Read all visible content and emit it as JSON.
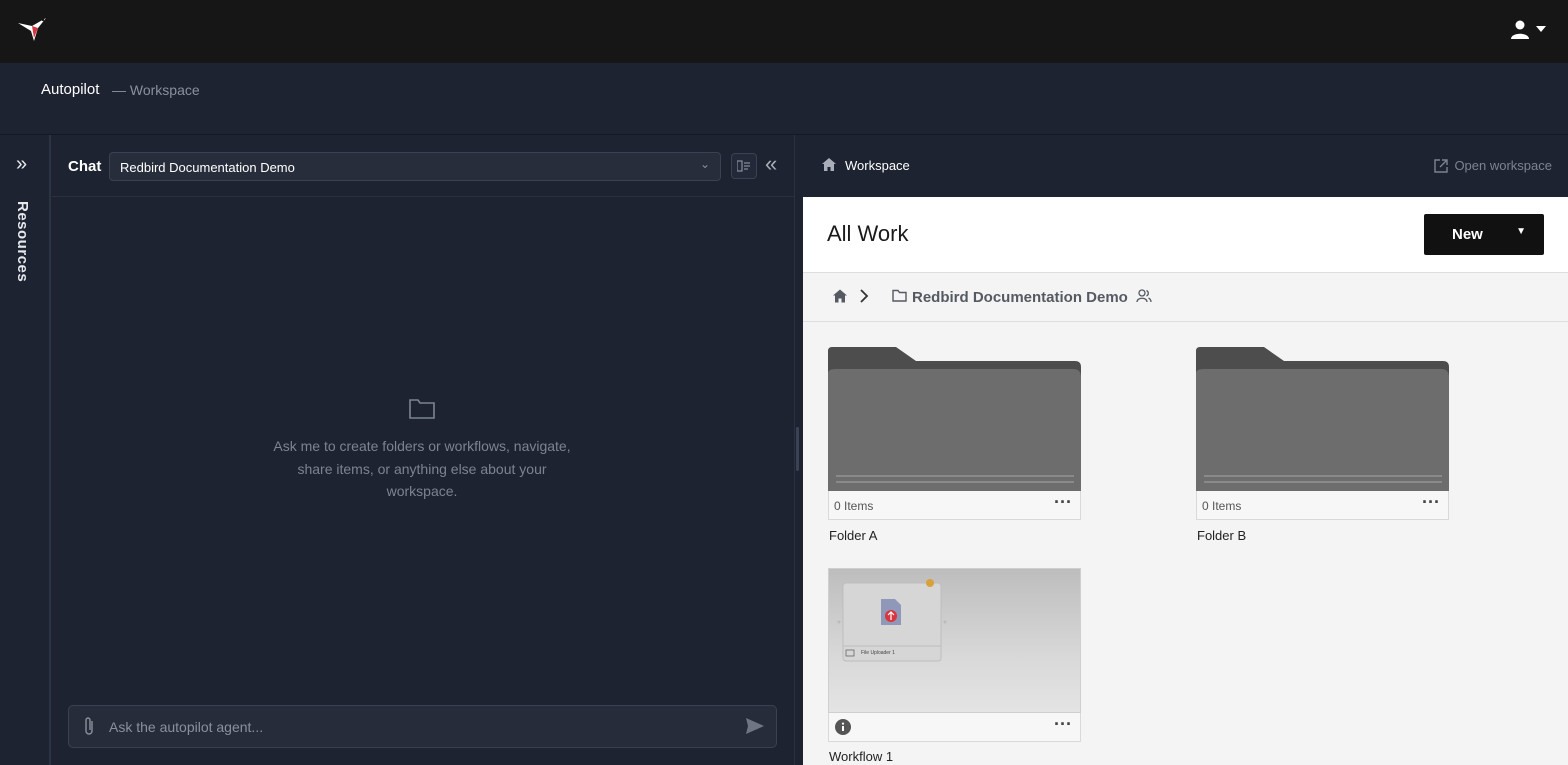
{
  "topbar": {
    "logo_icon": "hummingbird-logo",
    "user_icon": "user-icon"
  },
  "subheader": {
    "title": "Autopilot",
    "subtitle": "— Workspace"
  },
  "rail": {
    "label": "Resources"
  },
  "chat": {
    "label": "Chat",
    "selected_workspace": "Redbird Documentation Demo",
    "empty_message": "Ask me to create folders or workflows, navigate, share items, or anything else about your workspace.",
    "input_placeholder": "Ask the autopilot agent..."
  },
  "workspace": {
    "header_title": "Workspace",
    "open_link": "Open workspace",
    "panel_title": "All Work",
    "new_button": "New",
    "breadcrumb_folder": "Redbird Documentation Demo",
    "items": [
      {
        "name": "Folder A",
        "type": "folder",
        "count": "0 Items"
      },
      {
        "name": "Folder B",
        "type": "folder",
        "count": "0 Items"
      },
      {
        "name": "Workflow 1",
        "type": "workflow",
        "node_label": "File Uploader 1"
      }
    ]
  },
  "colors": {
    "topbar": "#161616",
    "background": "#1d2331",
    "panel": "#f4f4f4",
    "accent": "#d9353f"
  }
}
